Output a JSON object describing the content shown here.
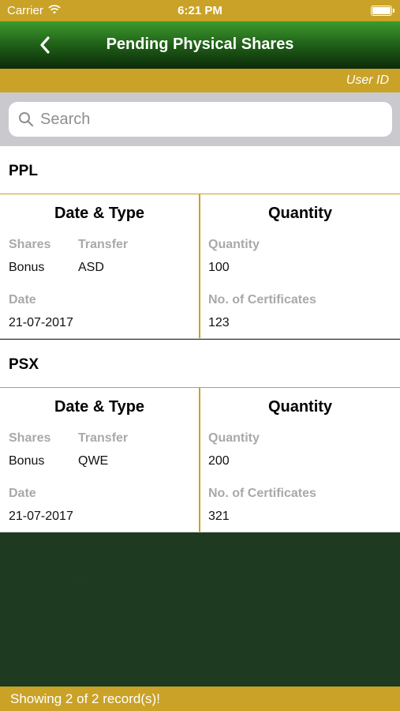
{
  "status_bar": {
    "carrier": "Carrier",
    "time": "6:21 PM"
  },
  "nav": {
    "title": "Pending Physical Shares"
  },
  "user_strip": {
    "label": "User ID"
  },
  "search": {
    "placeholder": "Search",
    "value": ""
  },
  "records": [
    {
      "symbol": "PPL",
      "left_header": "Date & Type",
      "right_header": "Quantity",
      "shares_label": "Shares",
      "shares_value": "Bonus",
      "transfer_label": "Transfer",
      "transfer_value": "ASD",
      "date_label": "Date",
      "date_value": "21-07-2017",
      "quantity_label": "Quantity",
      "quantity_value": "100",
      "certificates_label": "No. of Certificates",
      "certificates_value": "123"
    },
    {
      "symbol": "PSX",
      "left_header": "Date & Type",
      "right_header": "Quantity",
      "shares_label": "Shares",
      "shares_value": "Bonus",
      "transfer_label": "Transfer",
      "transfer_value": "QWE",
      "date_label": "Date",
      "date_value": "21-07-2017",
      "quantity_label": "Quantity",
      "quantity_value": "200",
      "certificates_label": "No. of Certificates",
      "certificates_value": "321"
    }
  ],
  "footer": {
    "text": "Showing 2 of 2 record(s)!"
  },
  "colors": {
    "gold": "#c9a227",
    "nav_green": "#1d5a16",
    "background_green": "#1e3a21"
  }
}
